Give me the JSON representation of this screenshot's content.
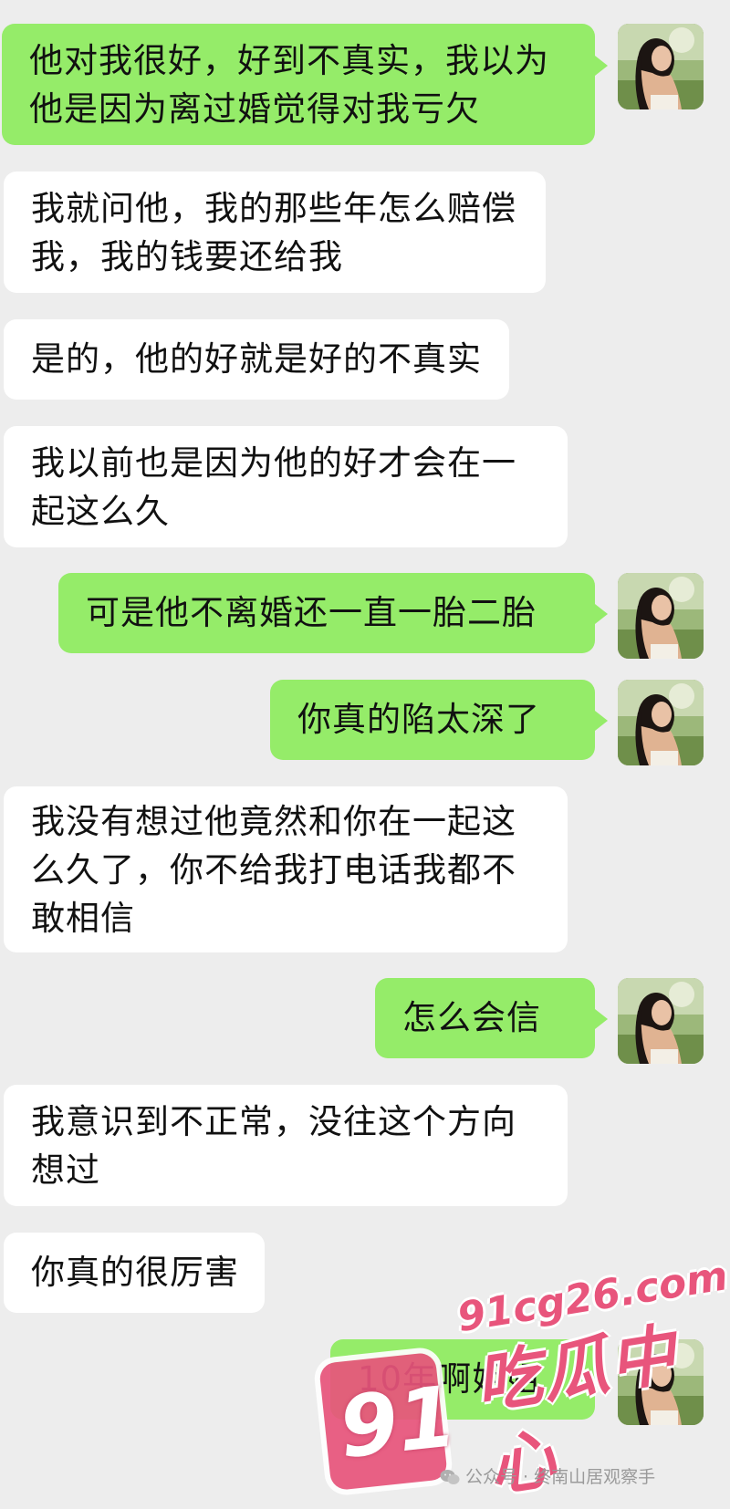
{
  "chat": {
    "messages": [
      {
        "side": "right",
        "text": "他对我很好，好到不真实，我以为他是因为离过婚觉得对我亏欠"
      },
      {
        "side": "left",
        "text": "我就问他，我的那些年怎么赔偿我，我的钱要还给我"
      },
      {
        "side": "left",
        "text": "是的，他的好就是好的不真实"
      },
      {
        "side": "left",
        "text": "我以前也是因为他的好才会在一起这么久"
      },
      {
        "side": "right",
        "text": "可是他不离婚还一直一胎二胎"
      },
      {
        "side": "right",
        "text": "你真的陷太深了"
      },
      {
        "side": "left",
        "text": "我没有想过他竟然和你在一起这么久了，你不给我打电话我都不敢相信"
      },
      {
        "side": "right",
        "text": "怎么会信"
      },
      {
        "side": "left",
        "text": "我意识到不正常，没往这个方向想过"
      },
      {
        "side": "left",
        "text": "你真的很厉害"
      },
      {
        "side": "right",
        "text": "10年啊姐姐"
      }
    ]
  },
  "watermark": {
    "number": "91",
    "domain": "91cg26.com",
    "brand": "吃瓜中心",
    "source": "公众号 · 终南山居观察手"
  },
  "colors": {
    "background": "#ededed",
    "outgoing_bubble": "#95ec69",
    "incoming_bubble": "#ffffff",
    "watermark_pink": "#e8557c"
  },
  "icons": {
    "avatar": "user-avatar-photo",
    "source": "wechat-icon"
  }
}
